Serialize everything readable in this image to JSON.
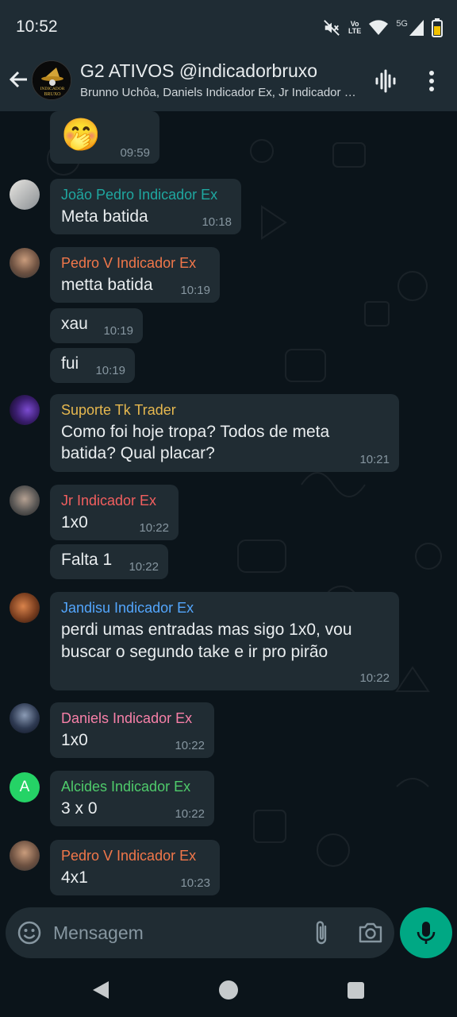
{
  "status": {
    "time": "10:52",
    "volte_top": "Vo",
    "volte_bottom": "LTE",
    "network": "5G",
    "icons": [
      "mute-icon",
      "volte-icon",
      "wifi-icon",
      "signal-icon",
      "battery-icon"
    ]
  },
  "header": {
    "title": "G2 ATIVOS @indicadorbruxo",
    "subtitle": "Brunno Uchôa, Daniels Indicador Ex, Jr Indicador Ex, Pedro V Indicador Ex",
    "avatar_text_1": "INDICADOR",
    "avatar_text_2": "BRUXO"
  },
  "messages": [
    {
      "sender": "",
      "text": "🤭",
      "time": "09:59"
    },
    {
      "sender": "João Pedro Indicador Ex",
      "sender_color": "#1fa7a0",
      "text": "Meta batida",
      "time": "10:18"
    },
    {
      "sender": "Pedro V Indicador Ex",
      "sender_color": "#f1774a",
      "text": "metta batida",
      "time": "10:19"
    },
    {
      "sender": "",
      "text": "xau",
      "time": "10:19"
    },
    {
      "sender": "",
      "text": "fui",
      "time": "10:19"
    },
    {
      "sender": "Suporte Tk Trader",
      "sender_color": "#e6b84f",
      "text_line1": "Como foi hoje tropa? Todos de meta",
      "text_line2": "batida? Qual placar?",
      "time": "10:21"
    },
    {
      "sender": "Jr Indicador Ex",
      "sender_color": "#f35f5f",
      "text": "1x0",
      "time": "10:22"
    },
    {
      "sender": "",
      "text": "Falta 1",
      "time": "10:22"
    },
    {
      "sender": "Jandisu Indicador Ex",
      "sender_color": "#53a6fd",
      "text_line1": "perdi umas entradas mas sigo 1x0, vou",
      "text_line2": "buscar o segundo take e ir pro pirão",
      "time": "10:22"
    },
    {
      "sender": "Daniels Indicador Ex",
      "sender_color": "#f780a8",
      "text": "1x0",
      "time": "10:22"
    },
    {
      "sender": "Alcides Indicador Ex",
      "sender_color": "#4fcb6b",
      "text": "3 x 0",
      "time": "10:22"
    },
    {
      "sender": "Pedro V Indicador Ex",
      "sender_color": "#f1774a",
      "text": "4x1",
      "time": "10:23"
    }
  ],
  "avatars": {
    "alcides_letter": "A"
  },
  "composer": {
    "placeholder": "Mensagem"
  },
  "colors": {
    "accent": "#00a884",
    "bubble": "#202c33",
    "background": "#0b141a",
    "header": "#1f2c34"
  }
}
